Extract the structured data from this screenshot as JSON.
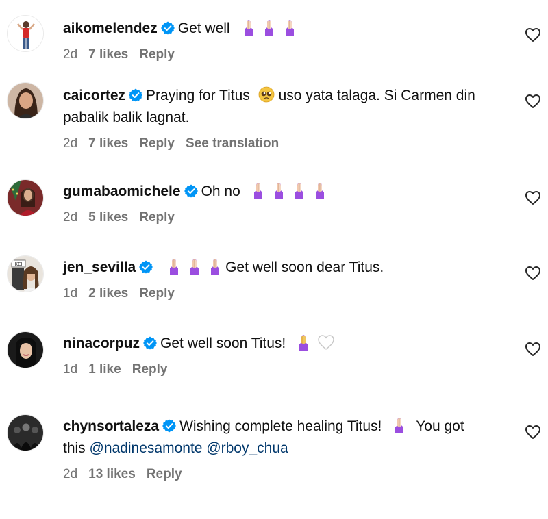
{
  "colors": {
    "verified_blue": "#0095f6",
    "mention_blue": "#00376b",
    "meta_gray": "#737373",
    "pray_purple": "#9b4ee0",
    "pray_skin": "#f2c9ad"
  },
  "icons": {
    "verified": "verified-badge-icon",
    "like": "heart-outline-icon",
    "pray": "folded-hands-emoji",
    "pleading": "pleading-face-emoji",
    "white_heart": "white-heart-emoji"
  },
  "comments": [
    {
      "username": "aikomelendez",
      "text": "Get well",
      "time": "2d",
      "likes": "7 likes",
      "reply": "Reply"
    },
    {
      "username": "caicortez",
      "text_a": "Praying for Titus",
      "text_b": "uso yata talaga. Si Carmen din",
      "text_c": "pabalik balik lagnat.",
      "time": "2d",
      "likes": "7 likes",
      "reply": "Reply",
      "translate": "See translation"
    },
    {
      "username": "gumabaomichele",
      "text": "Oh no",
      "time": "2d",
      "likes": "5 likes",
      "reply": "Reply"
    },
    {
      "username": "jen_sevilla",
      "text": "Get well soon dear Titus.",
      "time": "1d",
      "likes": "2 likes",
      "reply": "Reply"
    },
    {
      "username": "ninacorpuz",
      "text": "Get well soon Titus!",
      "time": "1d",
      "likes": "1 like",
      "reply": "Reply"
    },
    {
      "username": "chynsortaleza",
      "text_a": "Wishing complete healing Titus!",
      "text_b": "You got",
      "text_c": "this",
      "mention1": "@nadinesamonte",
      "mention2": "@rboy_chua",
      "time": "2d",
      "likes": "13 likes",
      "reply": "Reply"
    }
  ]
}
